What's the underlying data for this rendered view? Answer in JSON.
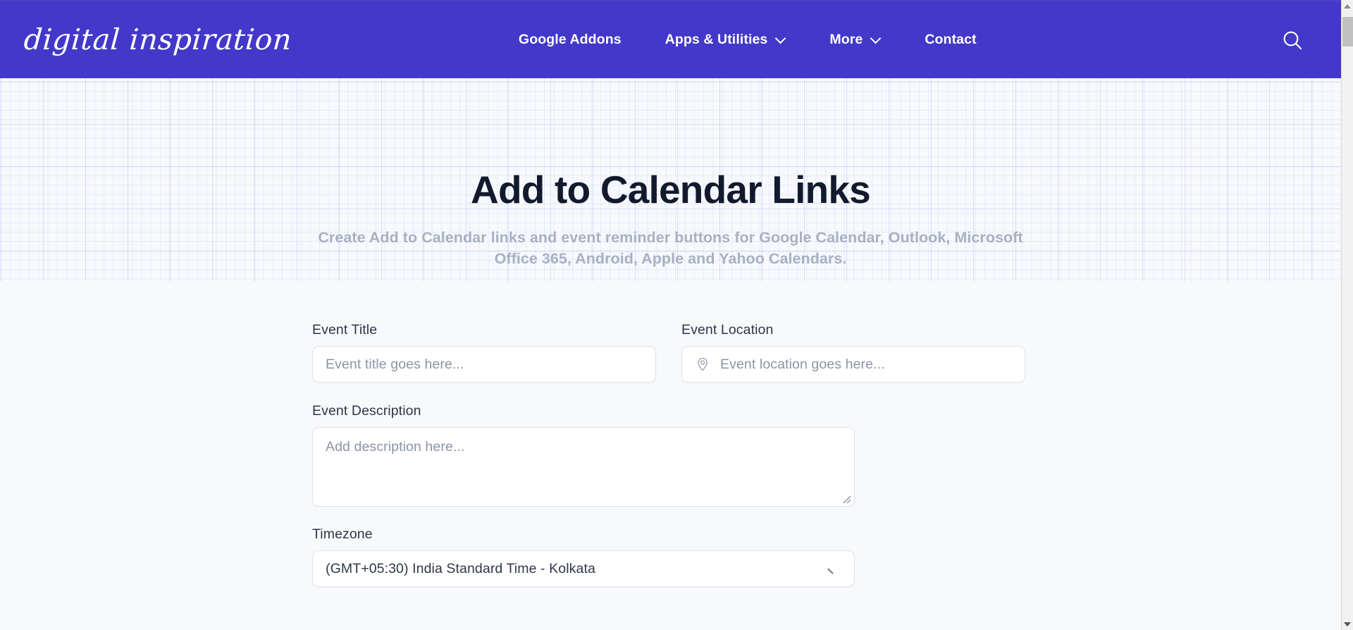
{
  "brand": {
    "name": "digital inspiration"
  },
  "nav": {
    "items": [
      {
        "label": "Google Addons",
        "has_dropdown": false
      },
      {
        "label": "Apps & Utilities",
        "has_dropdown": true
      },
      {
        "label": "More",
        "has_dropdown": true
      },
      {
        "label": "Contact",
        "has_dropdown": false
      }
    ],
    "search_icon": "search-icon"
  },
  "hero": {
    "title": "Add to Calendar Links",
    "subtitle": "Create Add to Calendar  links and event reminder buttons for Google Calendar, Outlook, Microsoft Office 365, Android, Apple and Yahoo Calendars."
  },
  "form": {
    "event_title": {
      "label": "Event Title",
      "placeholder": "Event title goes here...",
      "value": ""
    },
    "event_location": {
      "label": "Event Location",
      "placeholder": "Event location goes here...",
      "value": "",
      "icon": "map-pin-icon"
    },
    "event_description": {
      "label": "Event Description",
      "placeholder": "Add description here...",
      "value": ""
    },
    "timezone": {
      "label": "Timezone",
      "selected": "(GMT+05:30) India Standard Time - Kolkata"
    }
  },
  "colors": {
    "nav_background": "#4338ca",
    "hero_background": "#f8f9fc",
    "grid_line": "#bec8f5",
    "title_text": "#121a2e",
    "subtitle_text": "#a8b0c2",
    "page_background": "#f8f9fb",
    "input_border": "#dfe3ea"
  },
  "scrollbar": {
    "up_arrow": "scroll-up-arrow-icon",
    "down_arrow": "scroll-down-arrow-icon",
    "thumb": "scroll-thumb"
  }
}
